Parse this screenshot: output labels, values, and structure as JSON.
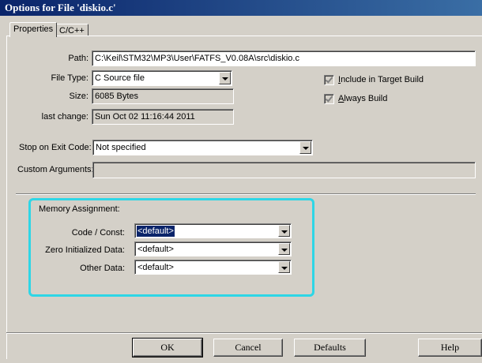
{
  "window": {
    "title": "Options for File 'diskio.c'"
  },
  "tabs": [
    {
      "label": "Properties"
    },
    {
      "label": "C/C++"
    }
  ],
  "properties": {
    "path_label": "Path:",
    "path_value": "C:\\Keil\\STM32\\MP3\\User\\FATFS_V0.08A\\src\\diskio.c",
    "file_type_label": "File Type:",
    "file_type_value": "C Source file",
    "size_label": "Size:",
    "size_value": "6085 Bytes",
    "last_change_label": "last change:",
    "last_change_value": "Sun Oct 02 11:16:44 2011",
    "include_label_underlined": "I",
    "include_label_rest": "nclude in Target Build",
    "include_checked": true,
    "always_label_underlined": "A",
    "always_label_rest": "lways Build",
    "always_checked": true,
    "stop_label": "Stop on Exit Code:",
    "stop_value": "Not specified",
    "custom_args_label": "Custom Arguments:",
    "custom_args_value": ""
  },
  "memory": {
    "title": "Memory Assignment:",
    "code_label": "Code / Const:",
    "code_value": "<default>",
    "zero_label": "Zero Initialized Data:",
    "zero_value": "<default>",
    "other_label": "Other Data:",
    "other_value": "<default>",
    "highlight_color": "#2ed6e6"
  },
  "buttons": {
    "ok": "OK",
    "cancel": "Cancel",
    "defaults": "Defaults",
    "help": "Help"
  }
}
